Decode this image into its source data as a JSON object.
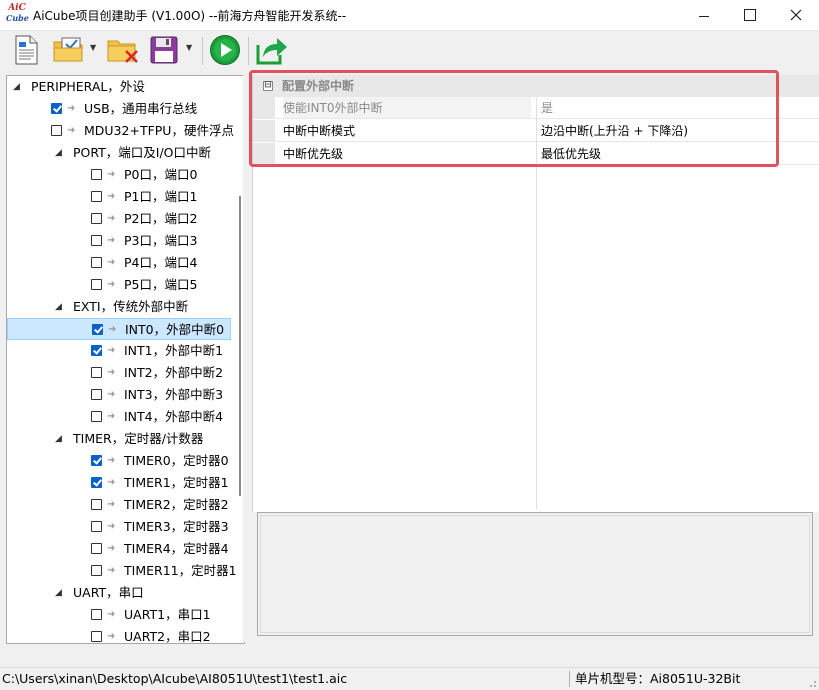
{
  "window": {
    "logo_line1": "AiC",
    "logo_line2": "Cube",
    "title": "AiCube项目创建助手 (V1.00O) --前海方舟智能开发系统--"
  },
  "toolbar": {
    "buttons": [
      {
        "name": "new-document-icon"
      },
      {
        "name": "open-checked-folder-icon",
        "has_dropdown": true
      },
      {
        "name": "delete-folder-icon"
      },
      {
        "name": "save-disk-icon",
        "has_dropdown": true
      },
      {
        "name": "run-play-icon"
      },
      {
        "name": "export-share-icon"
      }
    ]
  },
  "tree": {
    "items": [
      {
        "level": 0,
        "expander": "◢",
        "label": "PERIPHERAL，外设",
        "checkbox": null
      },
      {
        "level": 1,
        "label": "USB，通用串行总线",
        "checkbox": true
      },
      {
        "level": 1,
        "label": "MDU32+TFPU，硬件浮点",
        "checkbox": false
      },
      {
        "level": 1,
        "expander": "◢",
        "label": "PORT，端口及I/O口中断",
        "checkbox": null
      },
      {
        "level": 2,
        "label": "P0口，端口0",
        "checkbox": false
      },
      {
        "level": 2,
        "label": "P1口，端口1",
        "checkbox": false
      },
      {
        "level": 2,
        "label": "P2口，端口2",
        "checkbox": false
      },
      {
        "level": 2,
        "label": "P3口，端口3",
        "checkbox": false
      },
      {
        "level": 2,
        "label": "P4口，端口4",
        "checkbox": false
      },
      {
        "level": 2,
        "label": "P5口，端口5",
        "checkbox": false
      },
      {
        "level": 1,
        "expander": "◢",
        "label": "EXTI，传统外部中断",
        "checkbox": null
      },
      {
        "level": 2,
        "label": "INT0，外部中断0",
        "checkbox": true,
        "selected": true
      },
      {
        "level": 2,
        "label": "INT1，外部中断1",
        "checkbox": true
      },
      {
        "level": 2,
        "label": "INT2，外部中断2",
        "checkbox": false
      },
      {
        "level": 2,
        "label": "INT3，外部中断3",
        "checkbox": false
      },
      {
        "level": 2,
        "label": "INT4，外部中断4",
        "checkbox": false
      },
      {
        "level": 1,
        "expander": "◢",
        "label": "TIMER，定时器/计数器",
        "checkbox": null
      },
      {
        "level": 2,
        "label": "TIMER0，定时器0",
        "checkbox": true
      },
      {
        "level": 2,
        "label": "TIMER1，定时器1",
        "checkbox": true
      },
      {
        "level": 2,
        "label": "TIMER2，定时器2",
        "checkbox": false
      },
      {
        "level": 2,
        "label": "TIMER3，定时器3",
        "checkbox": false
      },
      {
        "level": 2,
        "label": "TIMER4，定时器4",
        "checkbox": false
      },
      {
        "level": 2,
        "label": "TIMER11，定时器11",
        "checkbox": false
      },
      {
        "level": 1,
        "expander": "◢",
        "label": "UART，串口",
        "checkbox": null
      },
      {
        "level": 2,
        "label": "UART1，串口1",
        "checkbox": false
      },
      {
        "level": 2,
        "label": "UART2，串口2",
        "checkbox": false
      }
    ]
  },
  "properties": {
    "category": "配置外部中断",
    "collapse_glyph": "⊟",
    "rows": [
      {
        "name": "使能INT0外部中断",
        "value": "是",
        "dim": true
      },
      {
        "name": "中断中断模式",
        "value": "边沿中断(上升沿 + 下降沿)",
        "dim": false
      },
      {
        "name": "中断优先级",
        "value": "最低优先级",
        "dim": false
      }
    ]
  },
  "status": {
    "path": "C:\\Users\\xinan\\Desktop\\AIcube\\AI8051U\\test1\\test1.aic",
    "chip": "单片机型号：Ai8051U-32Bit"
  },
  "colors": {
    "selection": "#cce8ff",
    "highlight_border": "#e0535e",
    "checkbox_checked": "#0a62c9",
    "run_green": "#1a9e3a"
  }
}
